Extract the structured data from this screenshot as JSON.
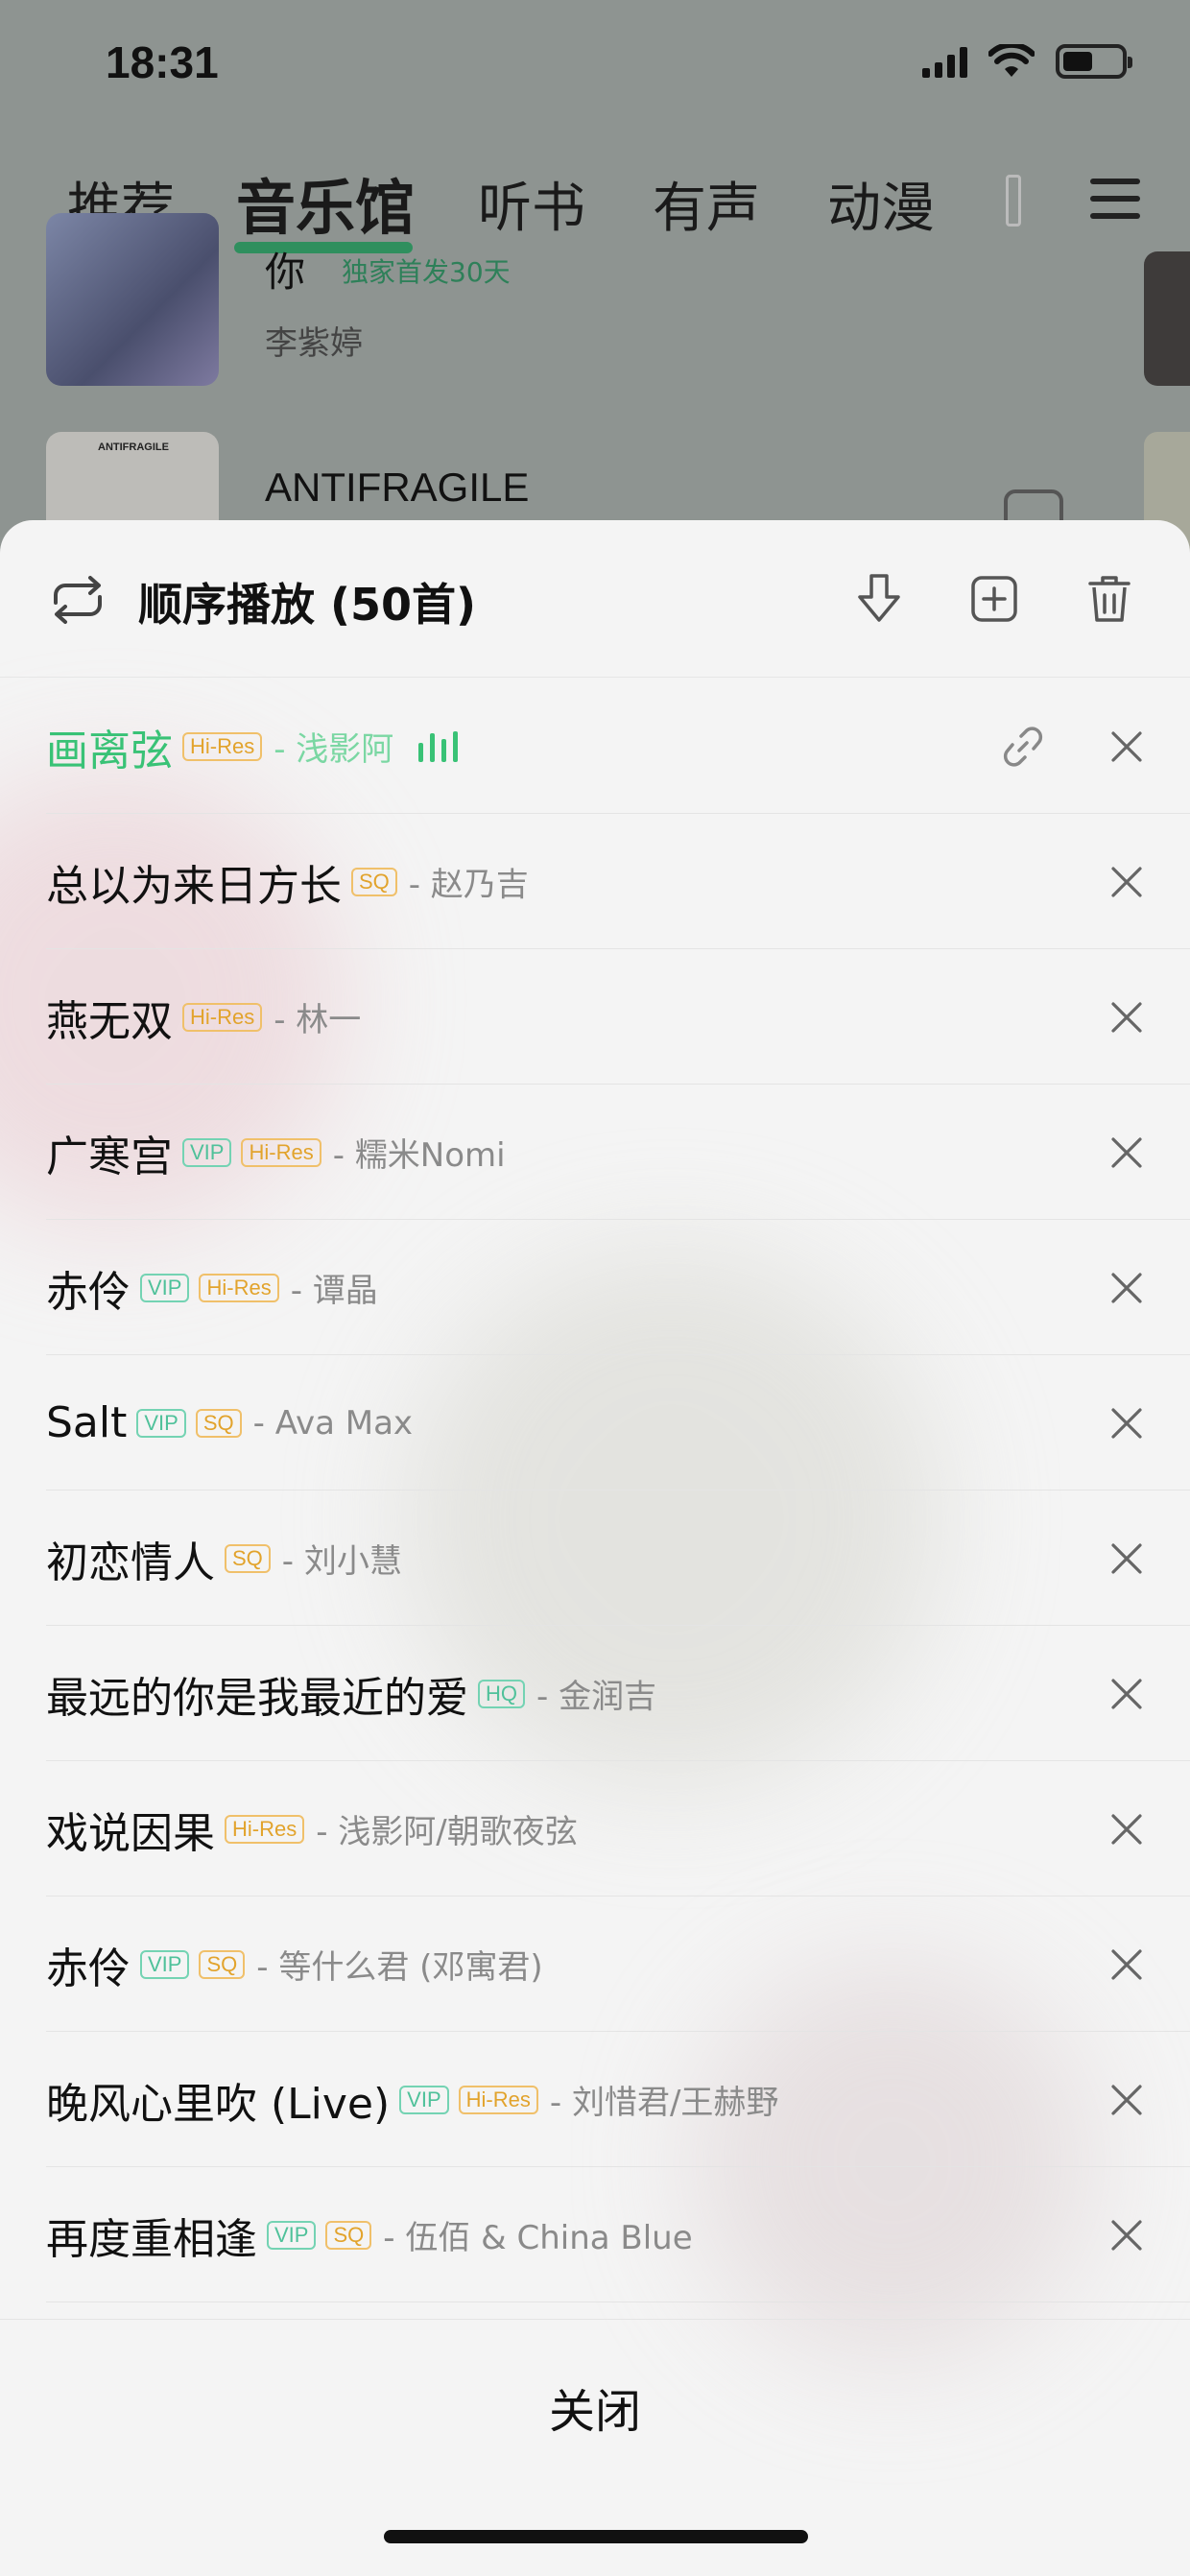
{
  "status_bar": {
    "time": "18:31"
  },
  "top_tabs": [
    {
      "label": "推荐",
      "active": false
    },
    {
      "label": "音乐馆",
      "active": true
    },
    {
      "label": "听书",
      "active": false
    },
    {
      "label": "有声",
      "active": false
    },
    {
      "label": "动漫",
      "active": false
    }
  ],
  "background_list": [
    {
      "title": "你",
      "tag": "独家首发30天",
      "artist": "李紫婷"
    },
    {
      "title": "ANTIFRAGILE",
      "cover_text": "ANTIFRAGILE"
    }
  ],
  "playlist": {
    "mode_title": "顺序播放 (50首)",
    "songs": [
      {
        "title": "画离弦",
        "badges": [
          "Hi-Res"
        ],
        "artist": "- 浅影阿",
        "playing": true
      },
      {
        "title": "总以为来日方长",
        "badges": [
          "SQ"
        ],
        "artist": "- 赵乃吉",
        "playing": false
      },
      {
        "title": "燕无双",
        "badges": [
          "Hi-Res"
        ],
        "artist": "- 林一",
        "playing": false
      },
      {
        "title": "广寒宫",
        "badges": [
          "VIP",
          "Hi-Res"
        ],
        "artist": "- 糯米Nomi",
        "playing": false
      },
      {
        "title": "赤伶",
        "badges": [
          "VIP",
          "Hi-Res"
        ],
        "artist": "- 谭晶",
        "playing": false
      },
      {
        "title": "Salt",
        "badges": [
          "VIP",
          "SQ"
        ],
        "artist": "- Ava Max",
        "playing": false
      },
      {
        "title": "初恋情人",
        "badges": [
          "SQ"
        ],
        "artist": "- 刘小慧",
        "playing": false
      },
      {
        "title": "最远的你是我最近的爱",
        "badges": [
          "HQ"
        ],
        "artist": "- 金润吉",
        "playing": false
      },
      {
        "title": "戏说因果",
        "badges": [
          "Hi-Res"
        ],
        "artist": "- 浅影阿/朝歌夜弦",
        "playing": false
      },
      {
        "title": "赤伶",
        "badges": [
          "VIP",
          "SQ"
        ],
        "artist": "- 等什么君 (邓寓君)",
        "playing": false
      },
      {
        "title": "晚风心里吹 (Live)",
        "badges": [
          "VIP",
          "Hi-Res"
        ],
        "artist": "- 刘惜君/王赫野",
        "playing": false
      },
      {
        "title": "再度重相逢",
        "badges": [
          "VIP",
          "SQ"
        ],
        "artist": "- 伍佰 & China Blue",
        "playing": false
      }
    ],
    "close_label": "关闭"
  },
  "colors": {
    "accent_green": "#39c276",
    "badge_gold": "#e2a32c",
    "badge_teal": "#4fc19a"
  }
}
